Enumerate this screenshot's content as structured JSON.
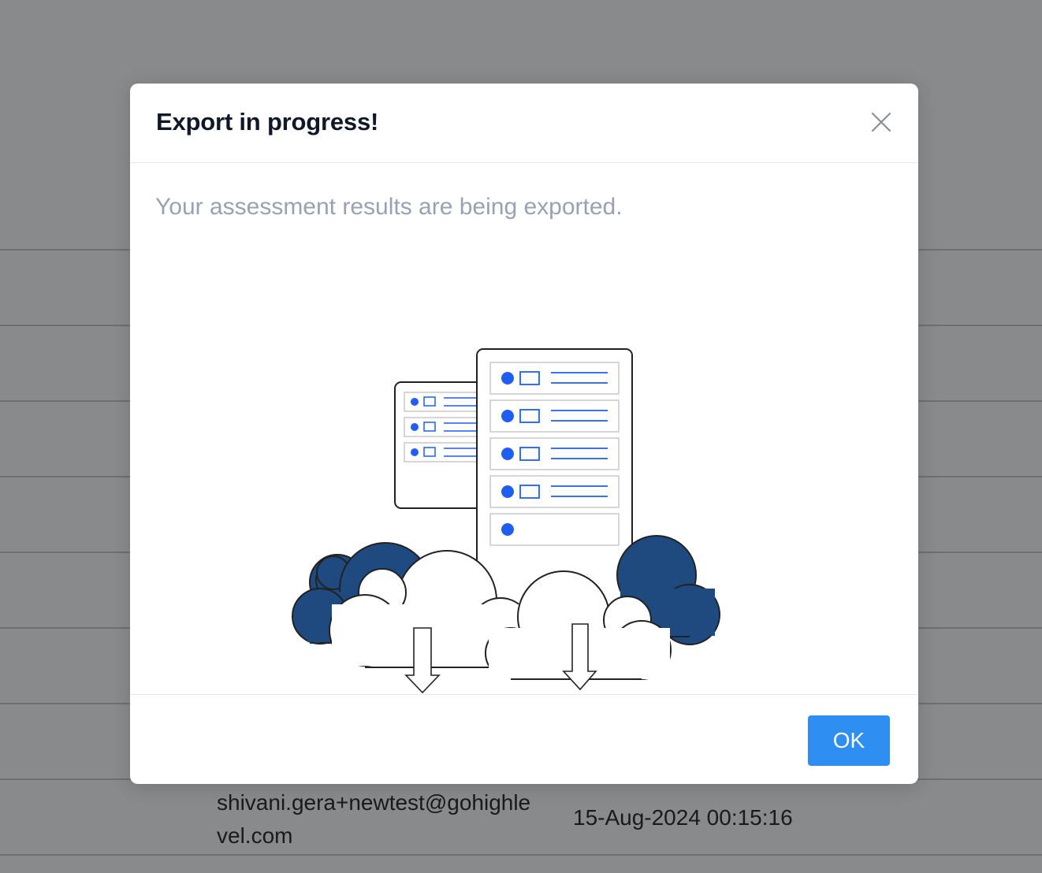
{
  "background": {
    "rows": [
      {
        "email": "shivani.gera+newtest@gohighlevel.com",
        "timestamp": "15-Aug-2024 00:15:16"
      }
    ]
  },
  "modal": {
    "title": "Export in progress!",
    "message": "Your assessment results are being exported.",
    "close_icon": "close-icon",
    "illustration": "cloud-server-export-illustration",
    "ok_label": "OK"
  },
  "colors": {
    "overlay": "#14161a80",
    "primary": "#2e8ef2",
    "cloud_dark": "#1e4a80",
    "accent_blue": "#1f5ef0",
    "title": "#101828",
    "message": "#98a2b3"
  }
}
